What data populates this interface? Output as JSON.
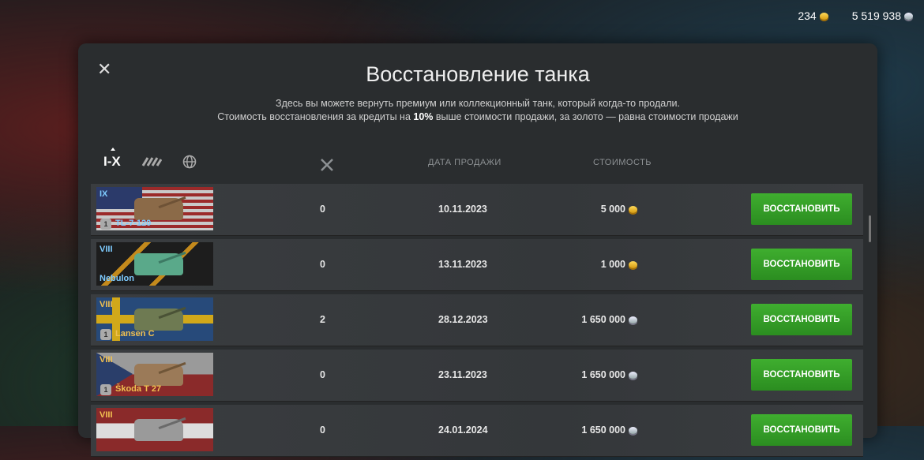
{
  "header": {
    "gold": "234",
    "credits": "5 519 938"
  },
  "dialog": {
    "title": "Восстановление танка",
    "desc_line1": "Здесь вы можете вернуть премиум или коллекционный танк, который когда-то продали.",
    "desc_line2_pre": "Стоимость восстановления за кредиты на ",
    "desc_line2_bold": "10%",
    "desc_line2_post": " выше стоимости продажи, за золото — равна стоимости продажи"
  },
  "filters": {
    "tier_filter": "I-X"
  },
  "columns": {
    "date": "ДАТА ПРОДАЖИ",
    "cost": "СТОИМОСТЬ"
  },
  "rows": [
    {
      "tier": "IX",
      "name": "TL-7-120",
      "badge": "1",
      "count": "0",
      "date": "10.11.2023",
      "cost": "5 000",
      "currency": "gold",
      "button": "ВОССТАНОВИТЬ"
    },
    {
      "tier": "VIII",
      "name": "Nebulon",
      "badge": "",
      "count": "0",
      "date": "13.11.2023",
      "cost": "1 000",
      "currency": "gold",
      "button": "ВОССТАНОВИТЬ"
    },
    {
      "tier": "VIII",
      "name": "Lansen C",
      "badge": "1",
      "count": "2",
      "date": "28.12.2023",
      "cost": "1 650 000",
      "currency": "credits",
      "button": "ВОССТАНОВИТЬ"
    },
    {
      "tier": "VIII",
      "name": "Škoda T 27",
      "badge": "1",
      "count": "0",
      "date": "23.11.2023",
      "cost": "1 650 000",
      "currency": "credits",
      "button": "ВОССТАНОВИТЬ"
    },
    {
      "tier": "VIII",
      "name": "",
      "badge": "",
      "count": "0",
      "date": "24.01.2024",
      "cost": "1 650 000",
      "currency": "credits",
      "button": "ВОССТАНОВИТЬ"
    }
  ]
}
